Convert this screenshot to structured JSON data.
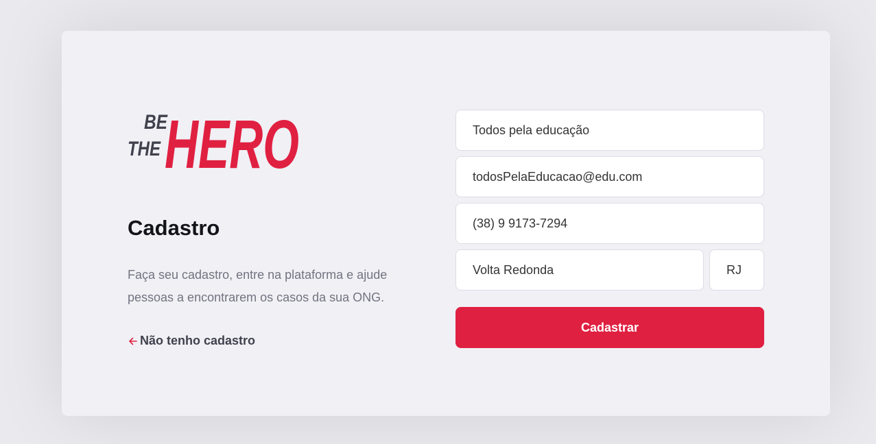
{
  "logo": {
    "line1": "BE",
    "line2": "THE",
    "line3": "HERO"
  },
  "title": "Cadastro",
  "description": "Faça seu cadastro, entre na plataforma e ajude pessoas a encontrarem os casos da sua ONG.",
  "back_link": {
    "label": "Não tenho cadastro",
    "icon": "arrow-left-icon"
  },
  "form": {
    "name": "Todos pela educação",
    "email": "todosPelaEducacao@edu.com",
    "whatsapp": "(38) 9 9173-7294",
    "city": "Volta Redonda",
    "uf": "RJ",
    "submit_label": "Cadastrar"
  },
  "colors": {
    "background": "#e9e9ee",
    "card": "#f0f0f5",
    "accent": "#e02041",
    "dark": "#41414d",
    "muted": "#737380"
  }
}
